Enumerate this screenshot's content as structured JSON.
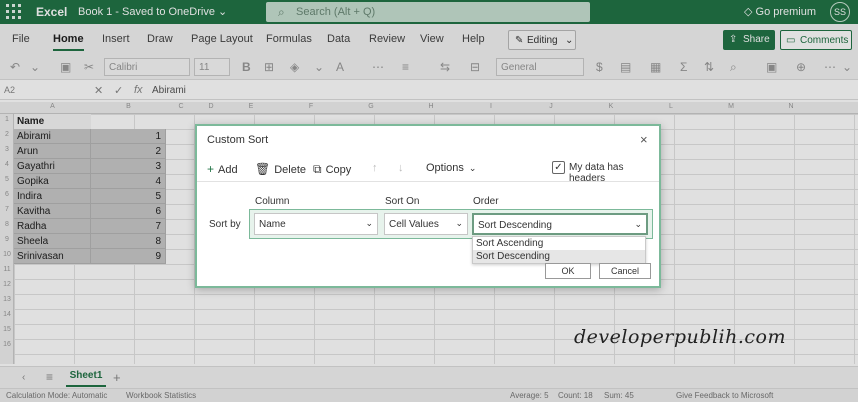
{
  "titlebar": {
    "app": "Excel",
    "document": "Book 1  -  Saved to OneDrive ⌄",
    "search_placeholder": "Search (Alt + Q)",
    "premium": "Go premium",
    "avatar": "SS",
    "brand_color": "#217346"
  },
  "ribbon": {
    "tabs": [
      "File",
      "Home",
      "Insert",
      "Draw",
      "Page Layout",
      "Formulas",
      "Data",
      "Review",
      "View",
      "Help"
    ],
    "active_tab": "Home",
    "editing": "Editing",
    "share": "Share",
    "comments": "Comments"
  },
  "toolbar": {
    "font": "Calibri",
    "size": "11",
    "number_format": "General"
  },
  "formulabar": {
    "namebox": "A2",
    "formula": "Abirami"
  },
  "grid": {
    "columns": [
      "A",
      "B",
      "C",
      "D",
      "E",
      "F",
      "G",
      "H",
      "I",
      "J",
      "K",
      "L",
      "M",
      "N"
    ],
    "rows": [
      "1",
      "2",
      "3",
      "4",
      "5",
      "6",
      "7",
      "8",
      "9",
      "10",
      "11",
      "12",
      "13",
      "14",
      "15",
      "16",
      "17",
      "18",
      "19",
      "20"
    ],
    "header": "Name",
    "names": [
      "Abirami",
      "Arun",
      "Gayathri",
      "Gopika",
      "Indira",
      "Kavitha",
      "Radha",
      "Sheela",
      "Srinivasan"
    ],
    "numbers": [
      "1",
      "2",
      "3",
      "4",
      "5",
      "6",
      "7",
      "8",
      "9"
    ]
  },
  "dialog": {
    "title": "Custom Sort",
    "close": "×",
    "toolbar": {
      "add": "Add",
      "delete": "Delete",
      "copy": "Copy",
      "options": "Options",
      "headers_label": "My data has headers",
      "headers_checked": true
    },
    "headers": {
      "column": "Column",
      "sort_on": "Sort On",
      "order": "Order"
    },
    "sort_by_label": "Sort by",
    "row": {
      "column": "Name",
      "sort_on": "Cell Values",
      "order": "Sort Descending"
    },
    "order_options": [
      "Sort Ascending",
      "Sort Descending"
    ],
    "ok": "OK",
    "cancel": "Cancel"
  },
  "sheetbar": {
    "sheet": "Sheet1",
    "add": "+"
  },
  "statusbar": {
    "left": "Calculation Mode: Automatic",
    "stats": "Workbook Statistics",
    "average": "Average: 5",
    "count": "Count: 18",
    "sum": "Sum: 45",
    "feedback": "Give Feedback to Microsoft"
  },
  "watermark": "developerpublih.com"
}
